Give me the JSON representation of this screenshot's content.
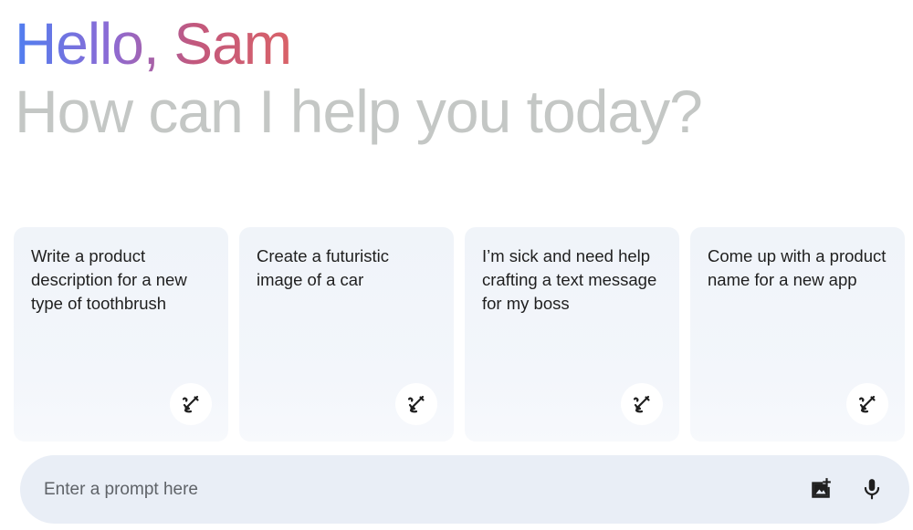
{
  "header": {
    "greeting": "Hello, Sam",
    "subtitle": "How can I help you today?"
  },
  "cards": [
    {
      "text": "Write a product description for a new type of toothbrush",
      "icon": "edit-sparkle-icon"
    },
    {
      "text": "Create a futuristic image of a car",
      "icon": "edit-sparkle-icon"
    },
    {
      "text": "I’m sick and need help crafting a text message for my boss",
      "icon": "edit-sparkle-icon"
    },
    {
      "text": "Come up with a product name for a new app",
      "icon": "edit-sparkle-icon"
    }
  ],
  "prompt": {
    "placeholder": "Enter a prompt here",
    "value": "",
    "image_button_icon": "add-image-icon",
    "mic_button_icon": "microphone-icon"
  },
  "colors": {
    "gradient_start": "#4f7ef0",
    "gradient_end": "#d96268",
    "subtitle": "#c4c7c5",
    "card_bg": "#f0f4f9",
    "prompt_bg": "#e9eef6"
  }
}
